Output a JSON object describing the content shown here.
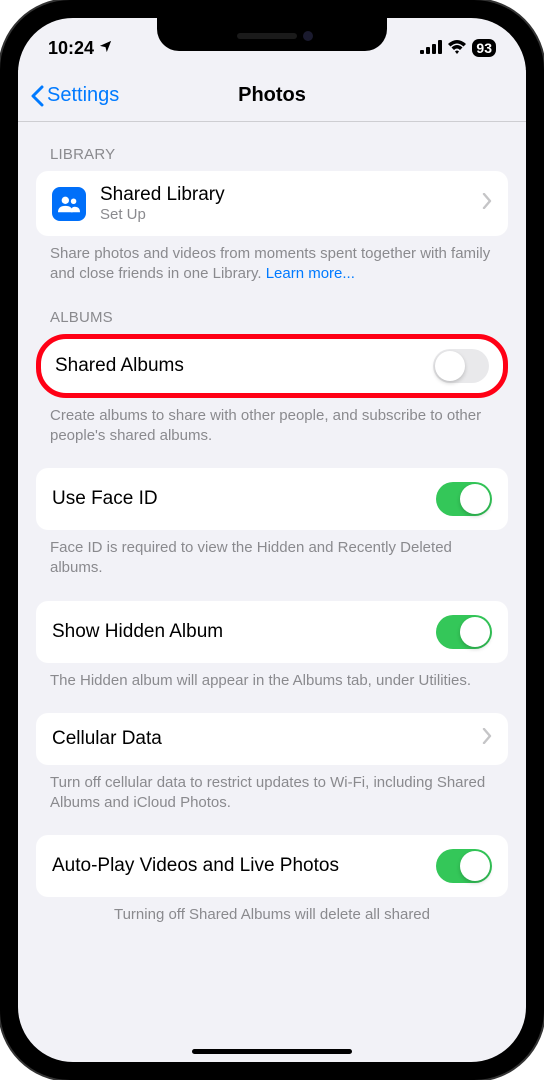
{
  "status_bar": {
    "time": "10:24",
    "battery": "93"
  },
  "nav": {
    "back": "Settings",
    "title": "Photos"
  },
  "library": {
    "header": "LIBRARY",
    "shared_library": {
      "title": "Shared Library",
      "subtitle": "Set Up"
    },
    "footer": "Share photos and videos from moments spent together with family and close friends in one Library.",
    "learn_more": "Learn more..."
  },
  "albums": {
    "header": "ALBUMS",
    "shared_albums": {
      "label": "Shared Albums",
      "on": false
    },
    "footer": "Create albums to share with other people, and subscribe to other people's shared albums."
  },
  "face_id": {
    "label": "Use Face ID",
    "on": true,
    "footer": "Face ID is required to view the Hidden and Recently Deleted albums."
  },
  "hidden": {
    "label": "Show Hidden Album",
    "on": true,
    "footer": "The Hidden album will appear in the Albums tab, under Utilities."
  },
  "cellular": {
    "label": "Cellular Data",
    "footer": "Turn off cellular data to restrict updates to Wi-Fi, including Shared Albums and iCloud Photos."
  },
  "autoplay": {
    "label": "Auto-Play Videos and Live Photos",
    "on": true,
    "footer": "Turning off Shared Albums will delete all shared"
  }
}
